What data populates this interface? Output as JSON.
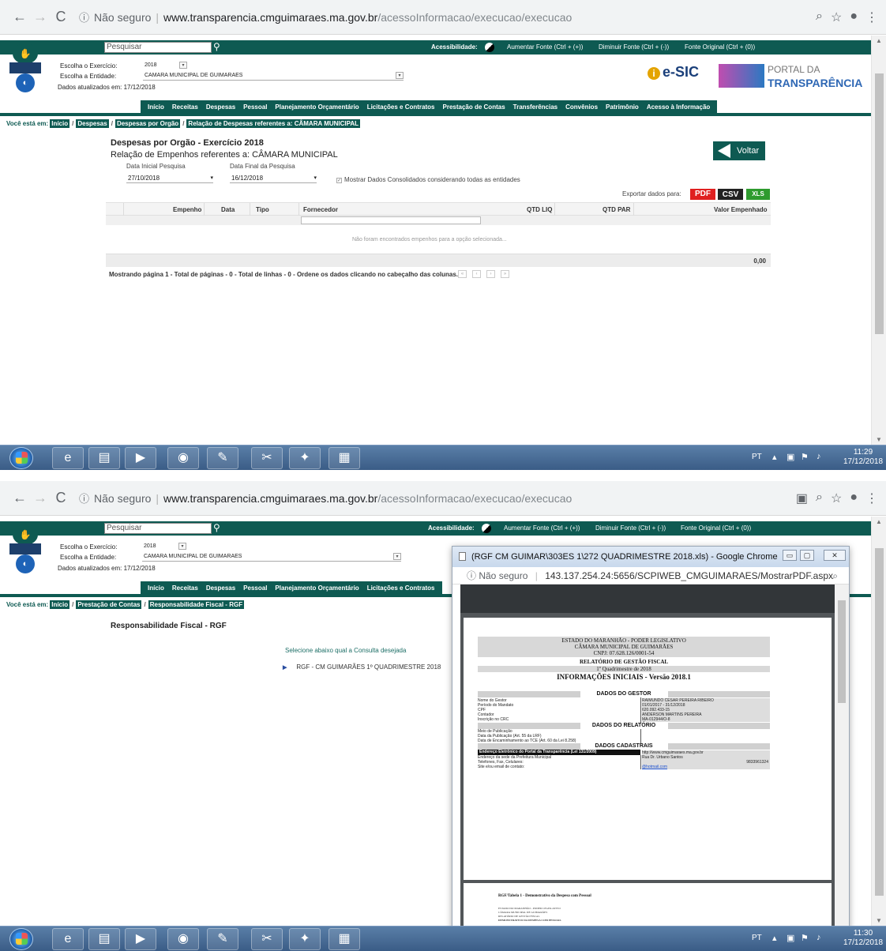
{
  "browser": {
    "security_label": "Não seguro",
    "url_host": "www.transparencia.cmguimaraes.ma.gov.br",
    "url_path": "/acessoInformacao/execucao/execucao"
  },
  "site": {
    "search_placeholder": "Pesquisar",
    "accessibility_label": "Acessibilidade:",
    "increase_font": "Aumentar Fonte (Ctrl + (+))",
    "decrease_font": "Diminuir Fonte (Ctrl + (-))",
    "original_font": "Fonte Original (Ctrl + (0))",
    "exercise_label": "Escolha o Exercício:",
    "exercise_value": "2018",
    "entity_label": "Escolha a Entidade:",
    "entity_value": "CAMARA MUNICIPAL DE GUIMARAES",
    "updated_label": "Dados atualizados em: 17/12/2018",
    "esic_label": "e-SIC",
    "portal_line1": "PORTAL DA",
    "portal_line2": "TRANSPARÊNCIA",
    "menu": [
      "Início",
      "Receitas",
      "Despesas",
      "Pessoal",
      "Planejamento Orçamentário",
      "Licitações e Contratos",
      "Prestação de Contas",
      "Transferências",
      "Convênios",
      "Patrimônio",
      "Acesso à Informação"
    ],
    "breadcrumb_prefix": "Você está em:"
  },
  "screen1": {
    "breadcrumb": [
      "Início",
      "Despesas",
      "Despesas por Orgão",
      "Relação de Despesas referentes a: CÂMARA MUNICIPAL"
    ],
    "title": "Despesas por Orgão - Exercício 2018",
    "subtitle": "Relação de Empenhos referentes a: CÂMARA MUNICIPAL",
    "start_date_label": "Data Inicial Pesquisa",
    "start_date": "27/10/2018",
    "end_date_label": "Data Final da Pesquisa",
    "end_date": "16/12/2018",
    "consolidated_label": "Mostrar Dados Consolidados considerando todas as entidades",
    "back_label": "Voltar",
    "export_label": "Exportar dados para:",
    "export_pdf": "PDF",
    "export_csv": "CSV",
    "export_xls": "XLS",
    "columns": [
      "Empenho",
      "Data",
      "Tipo",
      "Fornecedor",
      "QTD LIQ",
      "QTD PAR",
      "Valor Empenhado"
    ],
    "empty_message": "Não foram encontrados empenhos para a opção selecionada...",
    "total": "0,00",
    "pagination_text": "Mostrando página 1 - Total de páginas - 0 - Total de linhas - 0 - Ordene os dados clicando no cabeçalho das colunas."
  },
  "screen2": {
    "breadcrumb": [
      "Início",
      "Prestação de Contas",
      "Responsabilidade Fiscal - RGF"
    ],
    "title": "Responsabilidade Fiscal - RGF",
    "select_prompt": "Selecione abaixo qual a Consulta desejada",
    "rgf_item": "RGF - CM GUIMARÃES 1º QUADRIMESTRE 2018",
    "popup": {
      "title": "(RGF CM GUIMAR\\303ES 1\\272 QUADRIMESTRE 2018.xls) - Google Chrome",
      "security_label": "Não seguro",
      "url": "143.137.254.24:5656/SCPIWEB_CMGUIMARAES/MostrarPDF.aspx",
      "report": {
        "state": "ESTADO DO MARANHÃO - PODER LEGISLATIVO",
        "chamber": "CÂMARA MUNICIPAL DE GUIMARÃES",
        "cnpj": "CNPJ: 07.628.126/0001-54",
        "report_name": "RELATÓRIO DE GESTÃO FISCAL",
        "period": "1º Quadrimestre de 2018",
        "title": "INFORMAÇÕES INICIAIS - Versão 2018.1",
        "sec_gestor": "DADOS DO GESTOR",
        "gestor_rows": [
          {
            "label": "Nome do Gestor",
            "value": "RAIMUNDO CESAR PEREIRA RIBEIRO"
          },
          {
            "label": "Período do Mandato",
            "value": "01/01/2017 - 31/12/2018"
          },
          {
            "label": "CPF",
            "value": "620.092.433-15"
          },
          {
            "label": "Contador",
            "value": "ANDERSON MARTINS PEREIRA"
          },
          {
            "label": "Inscrição no CRC",
            "value": "MA-012944/O-8"
          }
        ],
        "sec_relatorio": "DADOS DO RELATÓRIO",
        "relatorio_rows": [
          "Meio de Publicação",
          "Data da Publicação (Art. 55 da LRF)",
          "Data de Encaminhamento ao TCE (Art. 60 da Lei 8.258)"
        ],
        "sec_cadastrais": "DADOS CADASTRAIS",
        "portal_row": "Endereço Eletrônico do Portal da Transparência (Lei 131/2009)",
        "portal_value": "http://www.cmguimaraes.ma.gov.br",
        "address_label": "Endereço da sede da Prefeitura Municipal",
        "address_value": "Rua Dr. Urbano Santos",
        "phones_label": "Telefones, Fax, Celulares:",
        "phones_value": "9833961324",
        "site_label": "Site e/ou email de contato:",
        "site_value": "@hotmail.com",
        "page2_title": "RGF/Tabela 1 - Demonstrativo da Despesa com Pessoal",
        "page2_lines": [
          "ESTADO DO MARANHÃO - PODER LEGISLATIVO",
          "CÂMARA MUNICIPAL DE GUIMARÃES",
          "RELATÓRIO DE GESTÃO FISCAL",
          "DEMONSTRATIVO DA DESPESA COM PESSOAL"
        ]
      }
    }
  },
  "taskbar": {
    "lang": "PT",
    "time1": "11:29",
    "date1": "17/12/2018",
    "time2": "11:30",
    "date2": "17/12/2018"
  }
}
